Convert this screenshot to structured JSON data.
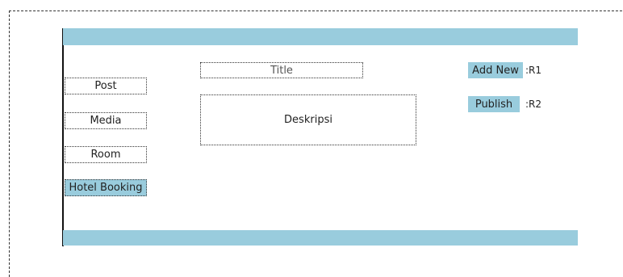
{
  "sidebar": {
    "items": [
      {
        "label": "Post"
      },
      {
        "label": "Media"
      },
      {
        "label": "Room"
      },
      {
        "label": "Hotel Booking"
      }
    ]
  },
  "form": {
    "title_placeholder": "Title",
    "description_placeholder": "Deskripsi"
  },
  "actions": {
    "add_new_label": "Add New",
    "add_new_ref": ":R1",
    "publish_label": "Publish",
    "publish_ref": ":R2"
  },
  "colors": {
    "accent": "#99ccdd",
    "border": "#333333",
    "background": "#ffffff"
  }
}
